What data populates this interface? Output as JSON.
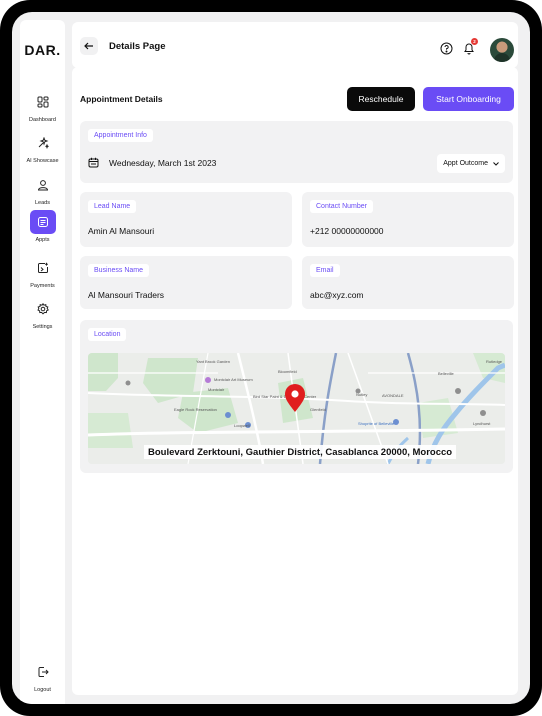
{
  "app": {
    "logo": "DAR."
  },
  "sidebar": {
    "items": [
      {
        "label": "Dashboard",
        "icon": "dashboard-grid-icon",
        "active": false
      },
      {
        "label": "AI Showcase",
        "icon": "sparkle-icon",
        "active": false
      },
      {
        "label": "Leads",
        "icon": "user-icon",
        "active": false
      },
      {
        "label": "Appts",
        "icon": "appointments-icon",
        "active": true
      },
      {
        "label": "Payments",
        "icon": "payments-icon",
        "active": false
      },
      {
        "label": "Settings",
        "icon": "gear-icon",
        "active": false
      }
    ],
    "logout_label": "Logout"
  },
  "header": {
    "title": "Details Page",
    "notification_count": "2"
  },
  "main": {
    "section_title": "Appointment Details",
    "reschedule_label": "Reschedule",
    "onboarding_label": "Start Onboarding",
    "appointment": {
      "chip": "Appointment Info",
      "date": "Wednesday, March 1st 2023",
      "outcome_label": "Appt Outcome"
    },
    "lead": {
      "label": "Lead Name",
      "value": "Amin Al Mansouri"
    },
    "contact": {
      "label": "Contact Number",
      "value": "+212 00000000000"
    },
    "business": {
      "label": "Business Name",
      "value": "Al Mansouri Traders"
    },
    "email": {
      "label": "Email",
      "value": "abc@xyz.com"
    },
    "location": {
      "label": "Location",
      "address": "Boulevard Zerktouni, Gauthier District, Casablanca 20000, Morocco",
      "map_labels": [
        "Montclair Art Museum",
        "Montclair",
        "Bird Star Paint & Decorating Center",
        "Glenfield",
        "Nutley",
        "AVONDALE",
        "Shoprite of Belleville",
        "Lyndhurst",
        "Eagle Rock Reservation",
        "Loopwell",
        "Yant Brook Garden",
        "Rutledge",
        "Belleville",
        "Bloomfield"
      ]
    }
  },
  "colors": {
    "accent": "#6a4cf5",
    "dark_button": "#0a0a0a",
    "card_bg": "#f2f2f3",
    "pin": "#e01e1e"
  }
}
